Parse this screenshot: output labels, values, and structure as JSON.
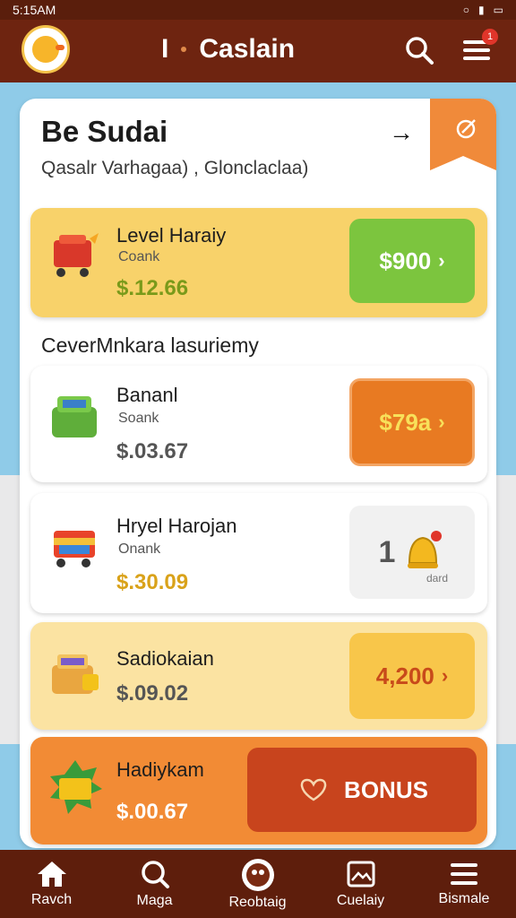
{
  "status_bar": {
    "time": "5:15AM"
  },
  "header": {
    "title_prefix": "I",
    "title": "Caslain",
    "menu_badge": "1"
  },
  "panel": {
    "title": "Be Sudai",
    "subtitle": "Qasalr Varhagaa) ,  Glonclaclaa)",
    "section_label": "CeverMnkara lasuriemy"
  },
  "featured": {
    "name": "Level Haraiy",
    "sub": "Coank",
    "price": "$.12.66",
    "button": "$900"
  },
  "items": [
    {
      "name": "Bananl",
      "sub": "Soank",
      "price": "$.03.67",
      "button": "$79a"
    },
    {
      "name": "Hryel Harojan",
      "sub": "Onank",
      "price": "$.30.09",
      "button_number": "1",
      "button_caption": "dard"
    },
    {
      "name": "Sadiokaian",
      "price": "$.09.02",
      "button": "4,200"
    },
    {
      "name": "Hadiykam",
      "price": "$.00.67",
      "button": "BONUS"
    }
  ],
  "bottom_nav": [
    {
      "label": "Ravch",
      "icon": "home-icon"
    },
    {
      "label": "Maga",
      "icon": "magnifier-icon"
    },
    {
      "label": "Reobtaig",
      "icon": "character-icon"
    },
    {
      "label": "Cuelaiy",
      "icon": "gallery-icon"
    },
    {
      "label": "Bismale",
      "icon": "menu-icon"
    }
  ],
  "colors": {
    "header": "#6e2410",
    "featured_bg": "#f8d26a",
    "green_button": "#7cc53e",
    "orange_button": "#e87a22",
    "bonus_card": "#f28b35",
    "bonus_button": "#c8441d",
    "nav_bg": "#5e1e0c"
  }
}
